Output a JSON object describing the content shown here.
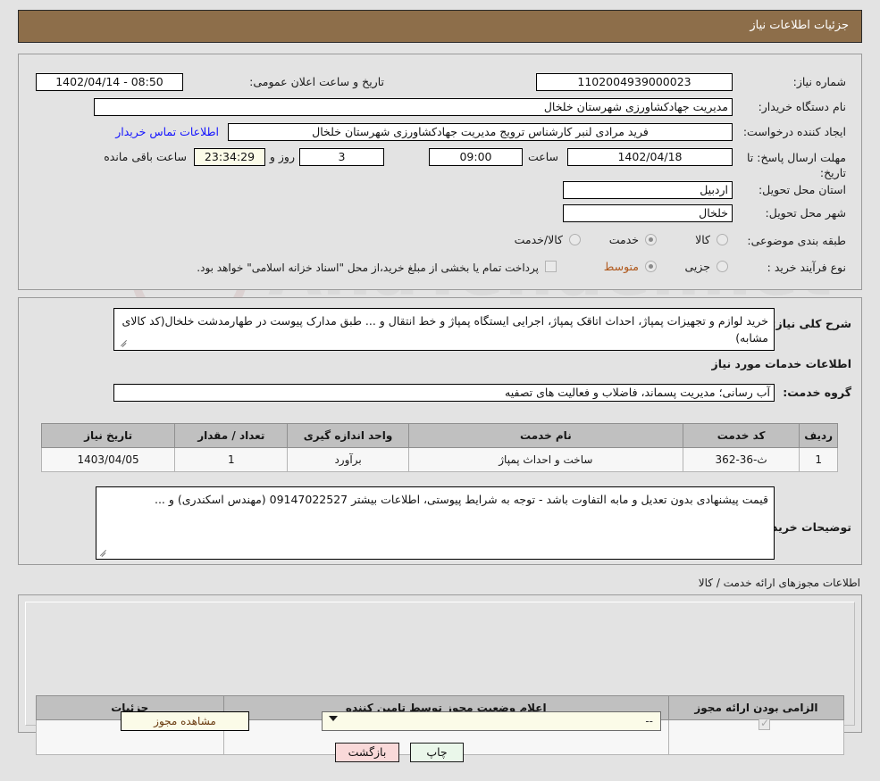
{
  "header": {
    "title": "جزئیات اطلاعات نیاز"
  },
  "top_form": {
    "need_number_label": "شماره نیاز:",
    "need_number_value": "1102004939000023",
    "announce_label": "تاریخ و ساعت اعلان عمومی:",
    "announce_value": "08:50 - 1402/04/14",
    "buyer_org_label": "نام دستگاه خریدار:",
    "buyer_org_value": "مدیریت جهادکشاورزی شهرستان خلخال",
    "creator_label": "ایجاد کننده درخواست:",
    "creator_value": "فرید مرادی لنبر کارشناس ترویج مدیریت جهادکشاورزی شهرستان خلخال",
    "contact_link": "اطلاعات تماس خریدار",
    "deadline_label": "مهلت ارسال پاسخ: تا تاریخ:",
    "deadline_date": "1402/04/18",
    "time_label": "ساعت",
    "deadline_time": "09:00",
    "days_value": "3",
    "days_label": "روز و",
    "countdown_value": "23:34:29",
    "countdown_label": "ساعت باقی مانده",
    "province_label": "استان محل تحویل:",
    "province_value": "اردبیل",
    "city_label": "شهر محل تحویل:",
    "city_value": "خلخال",
    "category_label": "طبقه بندی موضوعی:",
    "category_options": [
      "کالا",
      "خدمت",
      "کالا/خدمت"
    ],
    "category_selected": "خدمت",
    "process_label": "نوع فرآیند خرید :",
    "process_options": [
      "جزیی",
      "متوسط"
    ],
    "process_selected": "متوسط",
    "treasury_note": "پرداخت تمام یا بخشی از مبلغ خرید،از محل \"اسناد خزانه اسلامی\" خواهد بود."
  },
  "description": {
    "label": "شرح کلی نیاز:",
    "value": "خرید لوازم و تجهیزات پمپاژ، احداث اتاقک پمپاژ، اجرایی ایستگاه پمپاژ و خط انتقال و ... طبق مدارک پیوست در طهارمدشت خلخال(کد کالای مشابه)"
  },
  "services_section": {
    "heading": "اطلاعات خدمات مورد نیاز",
    "group_label": "گروه خدمت:",
    "group_value": "آب رسانی؛ مدیریت پسماند، فاضلاب و فعالیت های تصفیه",
    "table": {
      "headers": [
        "ردیف",
        "کد خدمت",
        "نام خدمت",
        "واحد اندازه گیری",
        "تعداد / مقدار",
        "تاریخ نیاز"
      ],
      "rows": [
        {
          "row_no": "1",
          "service_code": "ث-36-362",
          "service_name": "ساخت و احداث پمپاژ",
          "unit": "برآورد",
          "quantity": "1",
          "need_date": "1403/04/05"
        }
      ]
    }
  },
  "buyer_notes": {
    "label": "توضیحات خریدار:",
    "value": "قیمت پیشنهادی بدون تعدیل و مابه التفاوت باشد - توجه به شرایط پیوستی، اطلاعات بیشتر 09147022527 (مهندس اسکندری) و ..."
  },
  "licenses_section": {
    "heading": "اطلاعات مجوزهای ارائه خدمت / کالا",
    "table": {
      "headers": [
        "الزامی بودن ارائه مجوز",
        "اعلام وضعیت مجوز توسط تامین کننده",
        "جزئیات"
      ],
      "rows": [
        {
          "required_checked": "true",
          "status_value": "--",
          "details_button": "مشاهده مجوز"
        }
      ]
    }
  },
  "footer": {
    "print_label": "چاپ",
    "back_label": "بازگشت"
  },
  "colors": {
    "header_brown": "#8d6e4a",
    "page_background": "#e3e3e3",
    "link_blue": "#1414ff",
    "selected_orange": "#b05a1e",
    "cream_field": "#fbfbe8",
    "print_green": "#eaf7ea",
    "back_pink": "#f9d9d9"
  }
}
